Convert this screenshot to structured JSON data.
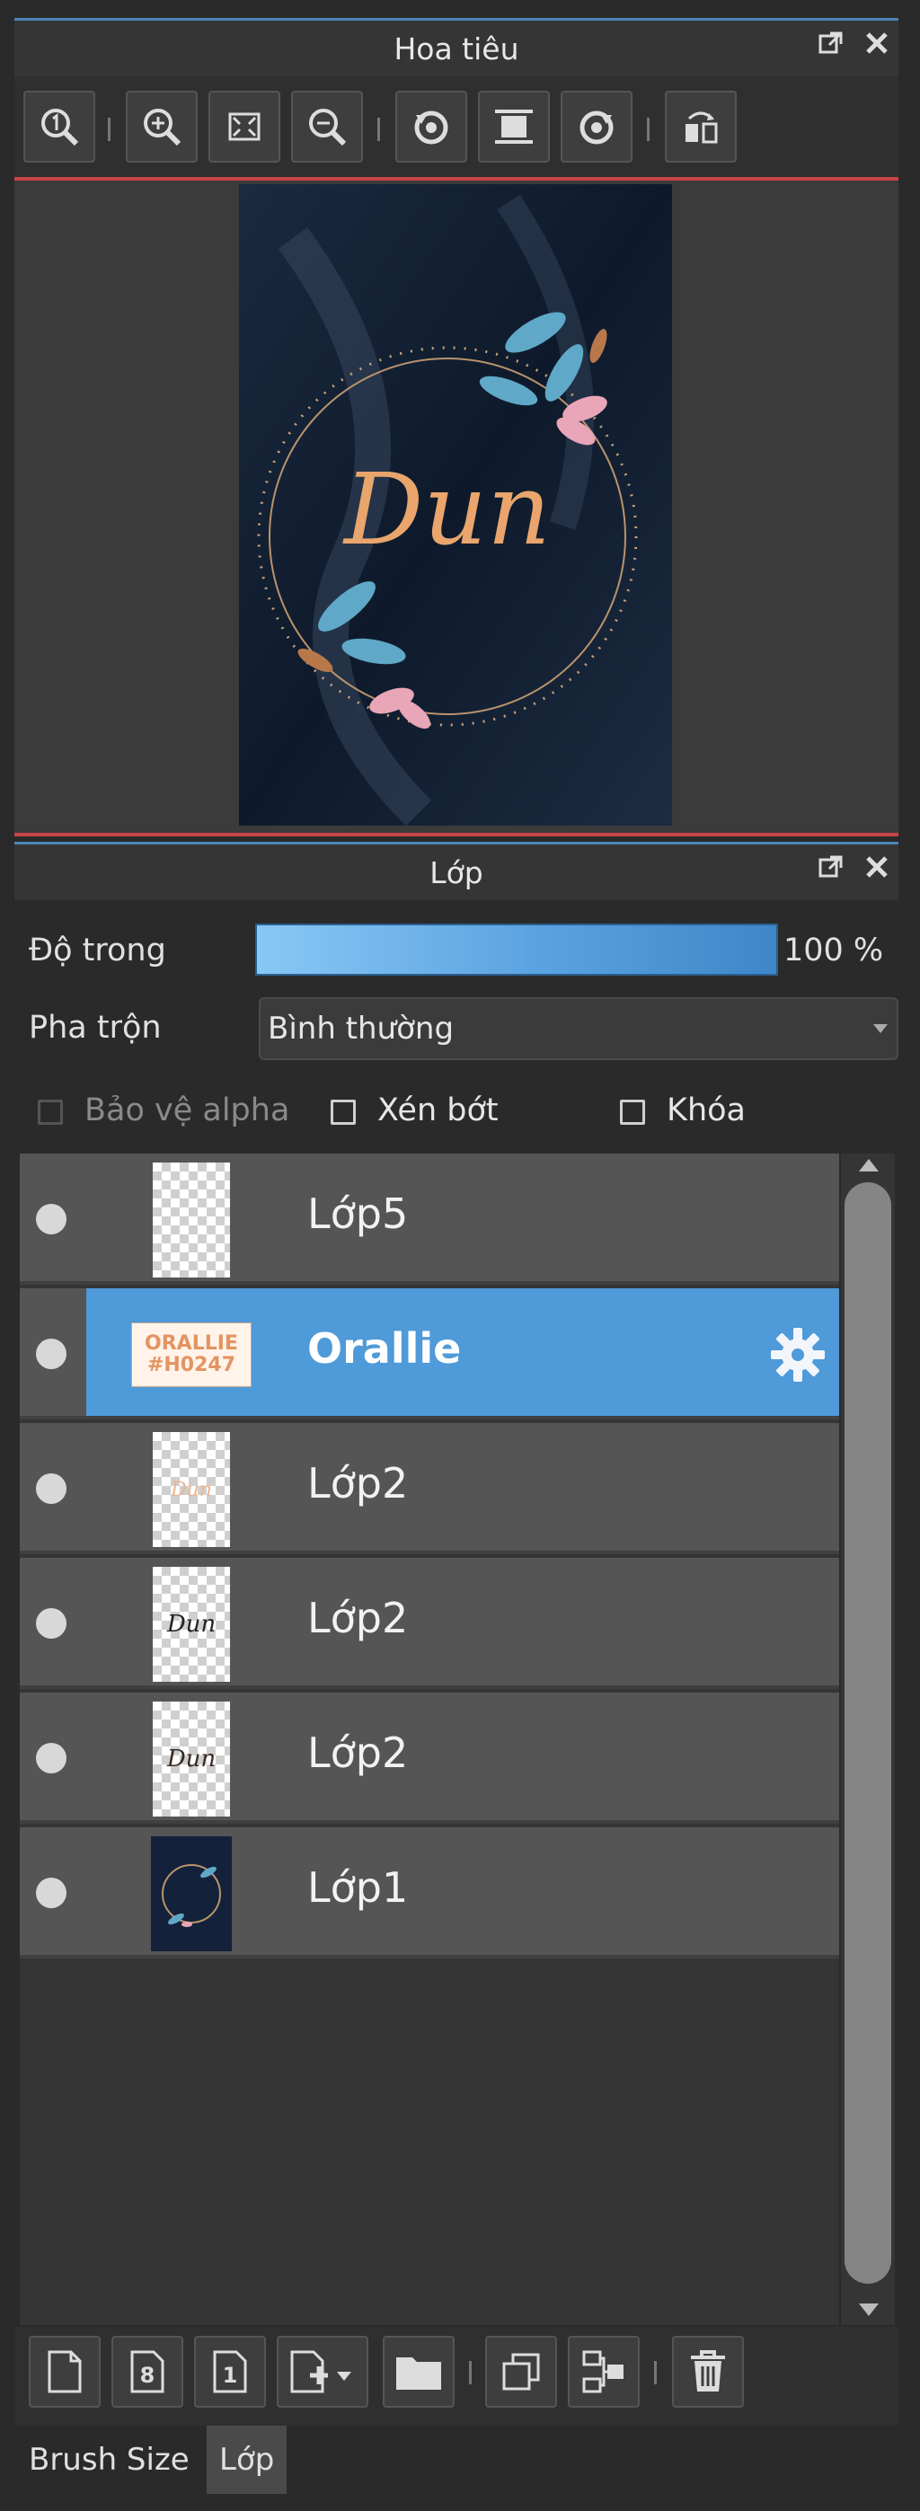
{
  "navigator": {
    "title": "Hoa tiêu",
    "toolbar_icons": [
      "zoom-actual-icon",
      "zoom-in-icon",
      "fit-screen-icon",
      "zoom-out-icon",
      "rotate-left-icon",
      "reset-view-icon",
      "rotate-right-icon",
      "flip-horizontal-icon"
    ],
    "preview_text": "Dun"
  },
  "layers_panel": {
    "title": "Lớp",
    "opacity_label": "Độ trong",
    "opacity_value": "100 %",
    "opacity_fraction": 1.0,
    "blend_label": "Pha trộn",
    "blend_value": "Bình thường",
    "protect_alpha_label": "Bảo vệ alpha",
    "clipping_label": "Xén bớt",
    "lock_label": "Khóa",
    "layers": [
      {
        "name": "Lớp5",
        "thumb": "transparent",
        "selected": false
      },
      {
        "name": "Orallie",
        "thumb": "text",
        "thumb_text": "ORALLIE #H0247",
        "selected": true
      },
      {
        "name": "Lớp2",
        "thumb": "transparent-faint",
        "thumb_text": "Dun",
        "selected": false
      },
      {
        "name": "Lớp2",
        "thumb": "transparent-script",
        "thumb_text": "Dun",
        "selected": false
      },
      {
        "name": "Lớp2",
        "thumb": "transparent-script",
        "thumb_text": "Dun",
        "selected": false
      },
      {
        "name": "Lớp1",
        "thumb": "dark-image",
        "selected": false
      }
    ],
    "bottom_icons": [
      "new-layer-icon",
      "new-layer-8bit-icon",
      "new-layer-1bit-icon",
      "add-layer-menu-icon",
      "new-folder-icon",
      "duplicate-layer-icon",
      "merge-down-icon",
      "delete-layer-icon"
    ]
  },
  "tabs": [
    {
      "label": "Brush Size",
      "active": false
    },
    {
      "label": "Lớp",
      "active": true
    }
  ],
  "colors": {
    "accent_blue": "#4f9ad8",
    "nav_border_red": "#c9434a",
    "panel_bg": "#2a2a2a"
  }
}
